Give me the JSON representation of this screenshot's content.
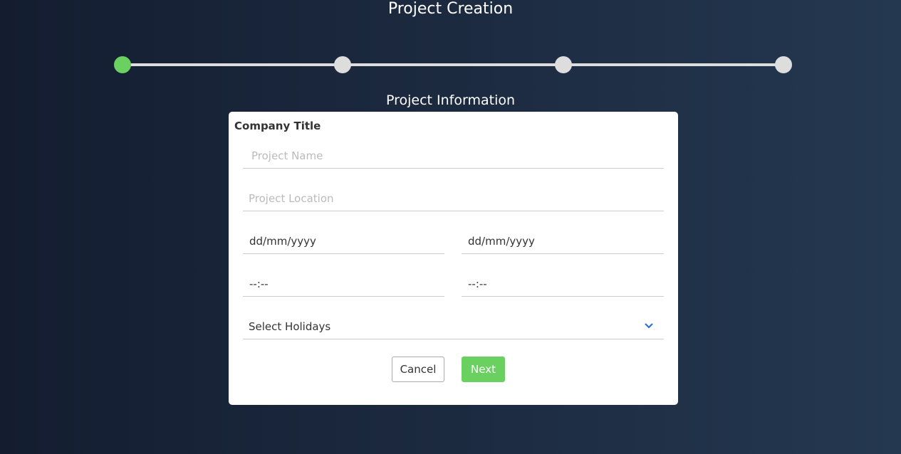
{
  "header": {
    "title": "Project Creation",
    "subtitle": "Project Information"
  },
  "stepper": {
    "steps": 4,
    "current_step": 1,
    "active_color": "#6ad161"
  },
  "form": {
    "company_title": "Company Title",
    "project_name_placeholder": "Project Name",
    "project_location_placeholder": "Project Location",
    "start_date": "dd/mm/yyyy",
    "end_date": "dd/mm/yyyy",
    "start_time": "--:--",
    "end_time": "--:--",
    "holidays": "Select Holidays",
    "cancel_label": "Cancel",
    "next_label": "Next"
  }
}
